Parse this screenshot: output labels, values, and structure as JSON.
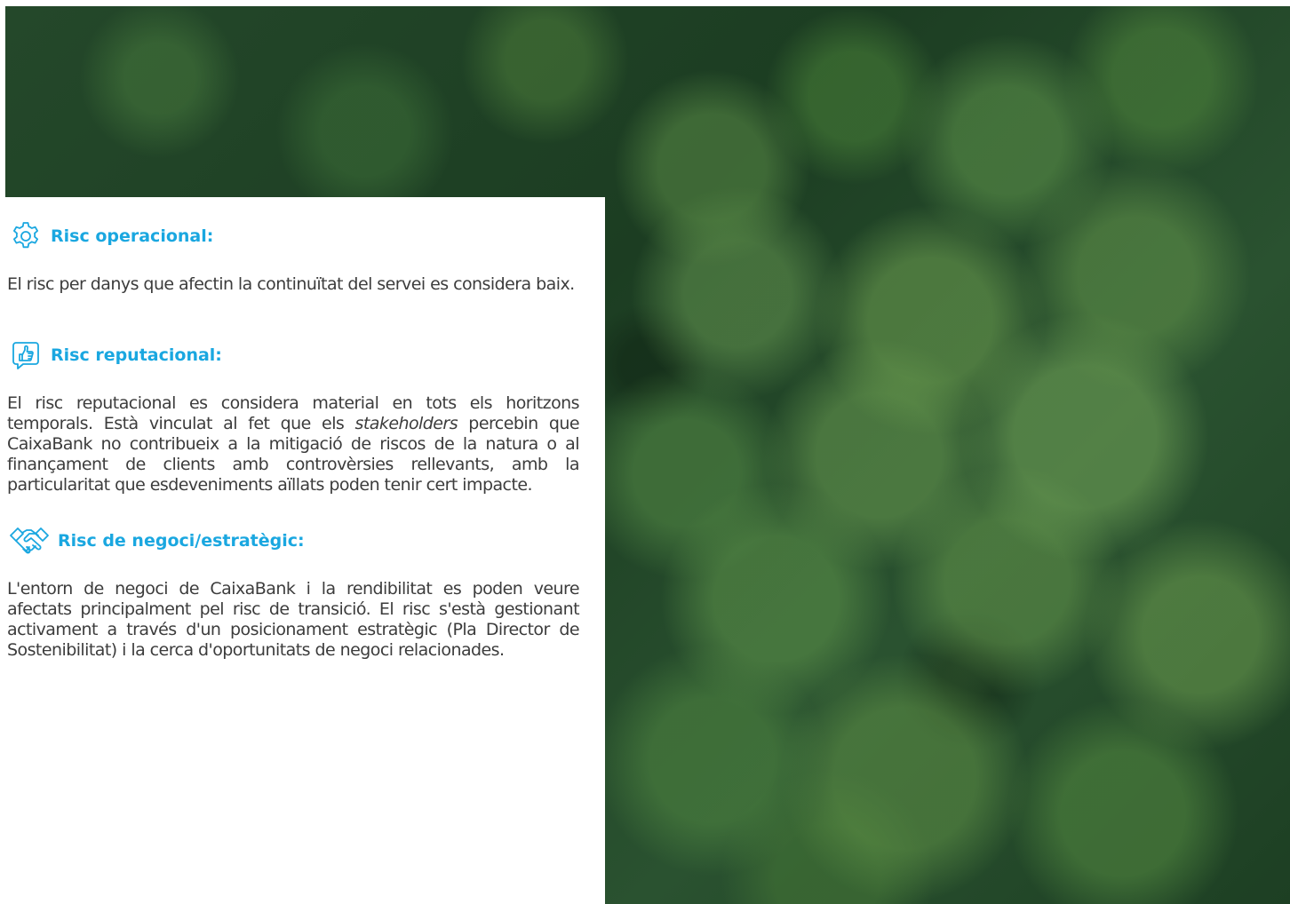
{
  "sections": [
    {
      "icon": "gear-icon",
      "title": "Risc operacional:",
      "body": "El risc per danys que afectin la continuïtat del servei es considera baix."
    },
    {
      "icon": "thumbs-up-icon",
      "title": "Risc reputacional:",
      "body_before": "El risc reputacional es considera material en tots els horitzons temporals. Està vinculat al fet que els ",
      "body_italic": "stakeholders",
      "body_after": " percebin que CaixaBank no contribueix a la mitigació de riscos de la natura o al finançament de clients amb controvèrsies rellevants, amb la particularitat que esdeveniments aïllats poden tenir cert impacte."
    },
    {
      "icon": "handshake-icon",
      "title": "Risc de negoci/estratègic:",
      "body": "L'entorn de negoci de CaixaBank i la rendibilitat es poden veure afectats principalment pel risc de transició. El risc s'està gestionant activament a través d'un posicionament estratègic (Pla Director de Sostenibilitat) i la cerca d'oportunitats de negoci relacionades."
    }
  ],
  "colors": {
    "accent": "#1aa7e0",
    "text": "#3c3c3c"
  },
  "background_image": "aerial-forest-photo"
}
